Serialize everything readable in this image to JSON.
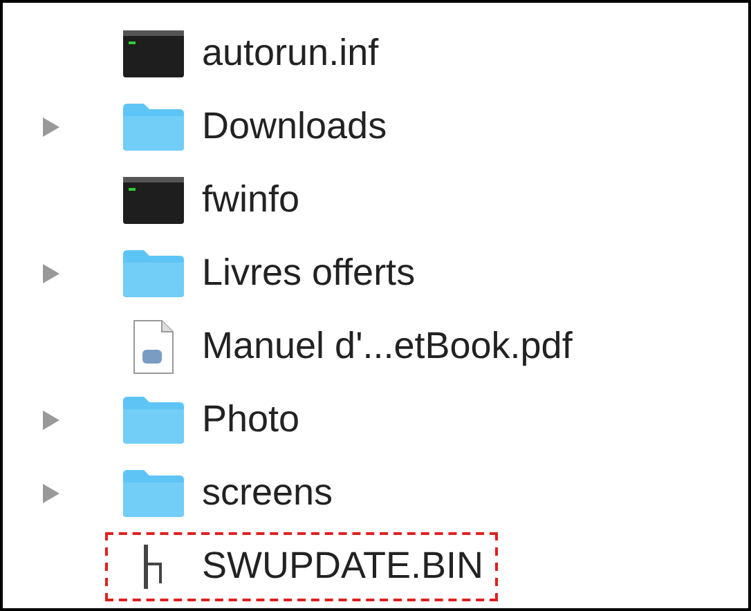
{
  "files": [
    {
      "name": "autorun.inf",
      "kind": "terminal",
      "annotated": false
    },
    {
      "name": "Downloads",
      "kind": "folder",
      "expanded": false,
      "annotated": false
    },
    {
      "name": "fwinfo",
      "kind": "terminal",
      "annotated": false
    },
    {
      "name": "Livres offerts",
      "kind": "folder",
      "expanded": false,
      "annotated": false
    },
    {
      "name": "Manuel d'...etBook.pdf",
      "kind": "pdf",
      "annotated": false
    },
    {
      "name": "Photo",
      "kind": "folder",
      "expanded": false,
      "annotated": false
    },
    {
      "name": "screens",
      "kind": "folder",
      "expanded": false,
      "annotated": false
    },
    {
      "name": "SWUPDATE.BIN",
      "kind": "binary",
      "annotated": true
    }
  ]
}
